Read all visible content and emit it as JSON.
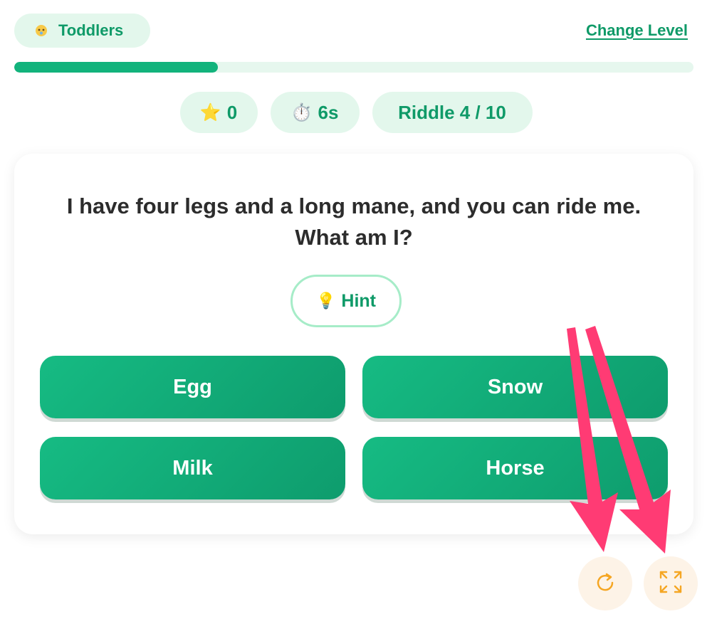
{
  "header": {
    "level_label": "Toddlers",
    "level_icon": "baby-icon",
    "change_level_label": "Change Level"
  },
  "progress": {
    "value_fraction": 0.3
  },
  "stats": {
    "stars_icon": "star-icon",
    "stars": "0",
    "timer_icon": "stopwatch-icon",
    "time": "6s",
    "riddle_label": "Riddle 4 / 10"
  },
  "question": {
    "line1": "I have four legs and a long mane, and you can ride me.",
    "line2": "What am I?"
  },
  "hint": {
    "icon": "lightbulb-icon",
    "label": "Hint"
  },
  "answers": [
    {
      "label": "Egg"
    },
    {
      "label": "Snow"
    },
    {
      "label": "Milk"
    },
    {
      "label": "Horse"
    }
  ],
  "controls": {
    "restart_icon": "restart-icon",
    "fullscreen_icon": "fullscreen-icon"
  },
  "colors": {
    "brand_green": "#0f9a68",
    "pill_bg": "#e3f7ec",
    "button_green": "#12b37c",
    "annotation_arrow": "#ff3b74",
    "control_icon": "#f5a623"
  }
}
